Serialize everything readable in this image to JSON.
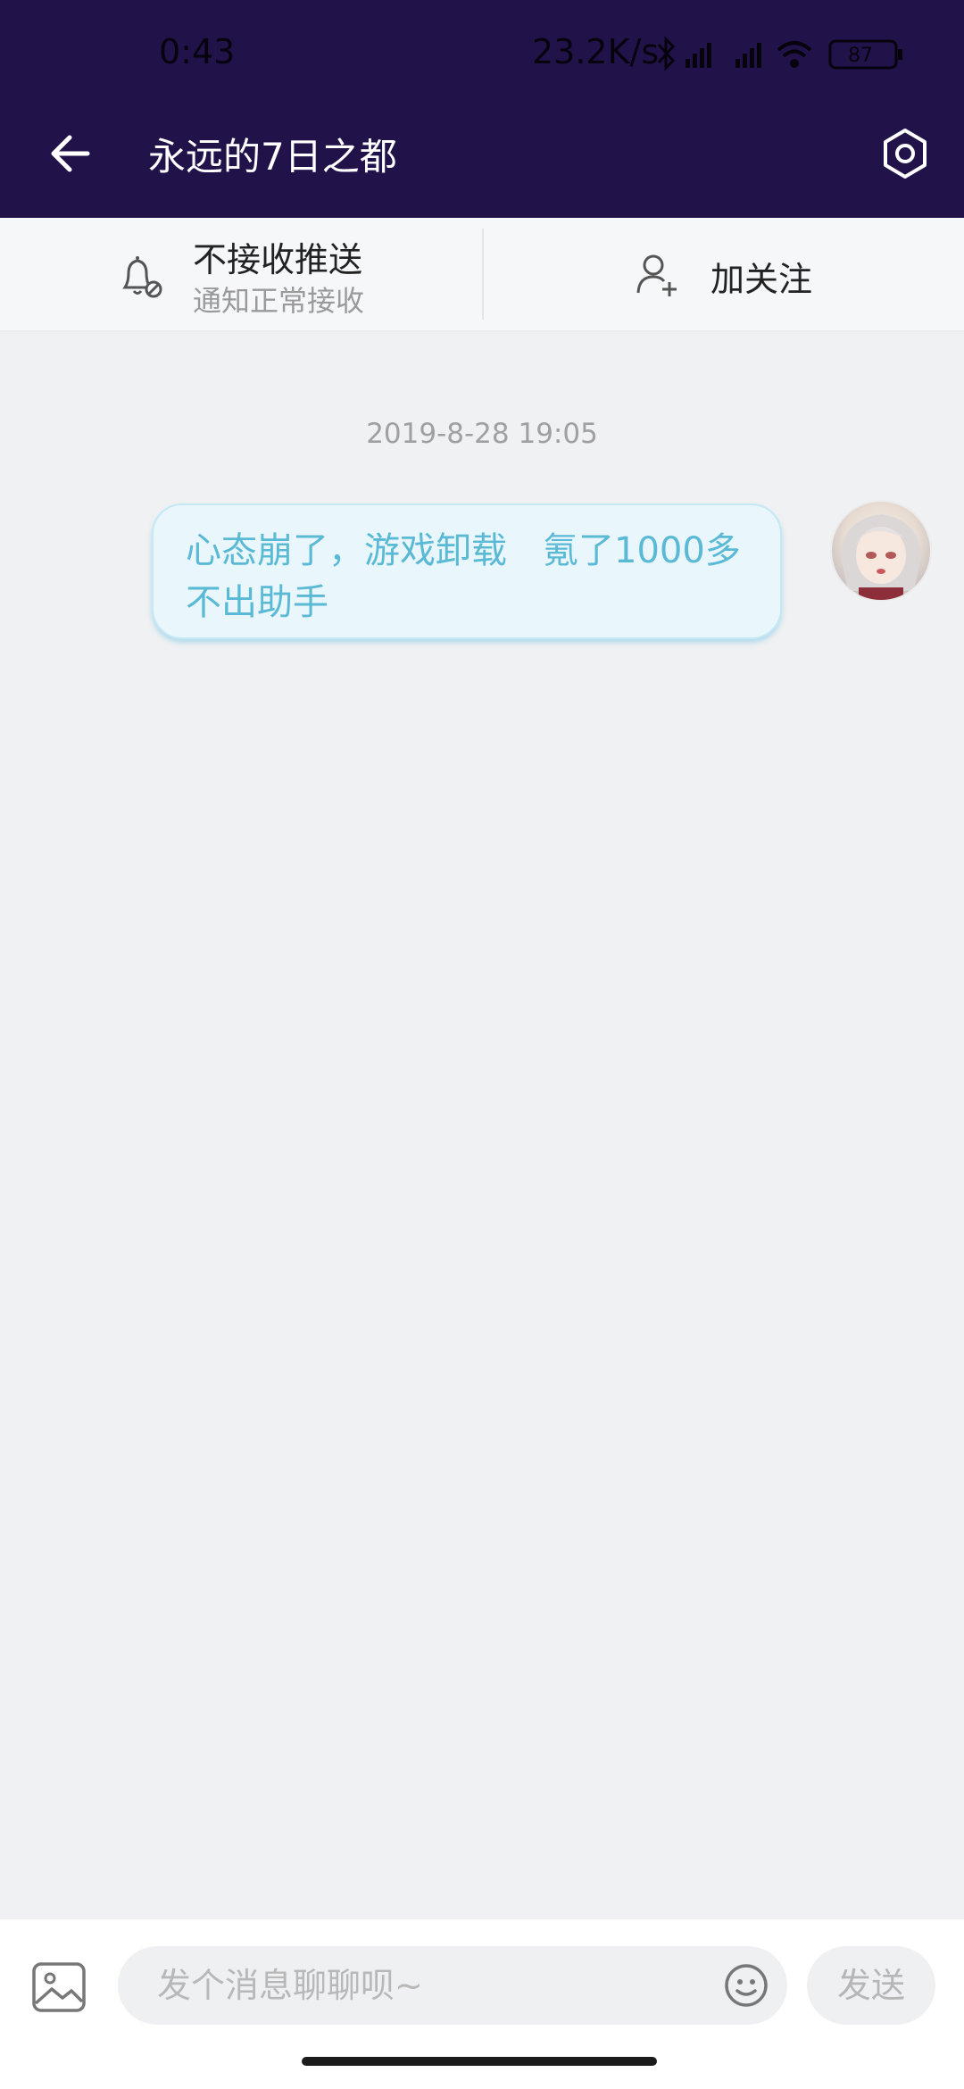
{
  "status_bar": {
    "time": "0:43",
    "net_speed": "23.2K/s",
    "battery": "87"
  },
  "header": {
    "title": "永远的7日之都"
  },
  "actions": {
    "notify_main": "不接收推送",
    "notify_sub": "通知正常接收",
    "follow_label": "加关注"
  },
  "chat": {
    "timestamp": "2019-8-28 19:05",
    "messages": [
      {
        "text": "心态崩了，游戏卸载　氪了1000多不出助手"
      }
    ]
  },
  "composer": {
    "placeholder": "发个消息聊聊呗~",
    "send_label": "发送"
  },
  "colors": {
    "header_bg": "#22124a",
    "bubble_bg": "#e9f7fd",
    "bubble_text": "#5ab9d4",
    "page_bg": "#f0f1f3"
  },
  "icons": [
    "back-arrow-icon",
    "settings-hexagon-icon",
    "bell-muted-icon",
    "add-user-icon",
    "image-icon",
    "emoji-icon"
  ]
}
